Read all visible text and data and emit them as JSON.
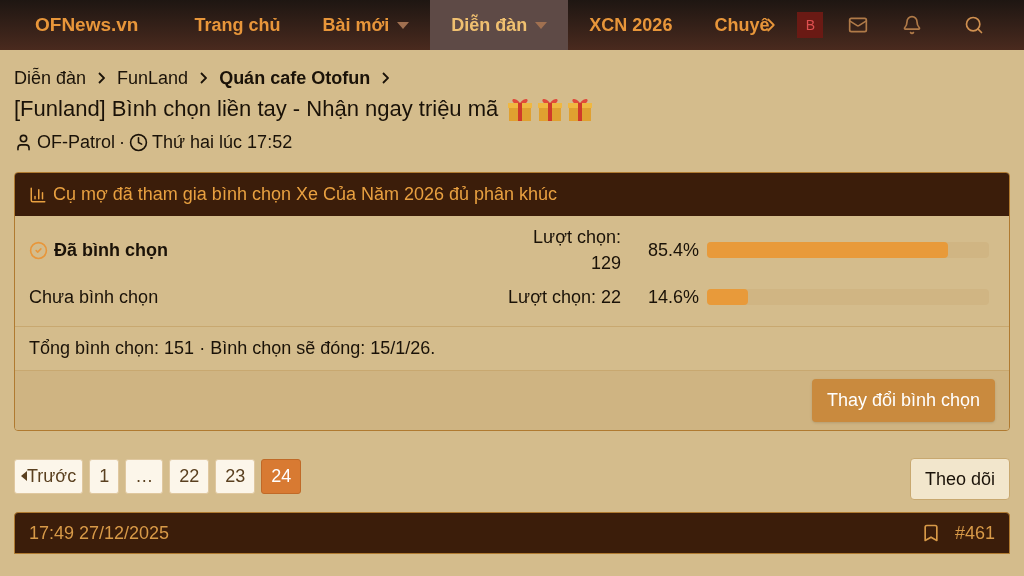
{
  "nav": {
    "logo": "OFNews.vn",
    "items": [
      {
        "label": "Trang chủ",
        "dropdown": false,
        "selected": false
      },
      {
        "label": "Bài mới",
        "dropdown": true,
        "selected": false
      },
      {
        "label": "Diễn đàn",
        "dropdown": true,
        "selected": true
      },
      {
        "label": "XCN 2026",
        "dropdown": false,
        "selected": false
      },
      {
        "label": "Chuyê",
        "dropdown": false,
        "selected": false
      }
    ],
    "avatar": "B"
  },
  "breadcrumb": [
    {
      "label": "Diễn đàn",
      "current": false
    },
    {
      "label": "FunLand",
      "current": false
    },
    {
      "label": "Quán cafe Otofun",
      "current": true
    }
  ],
  "thread": {
    "title": "[Funland] Bình chọn liền tay - Nhận ngay triệu mã",
    "author": "OF-Patrol",
    "separator": "·",
    "time": "Thứ hai lúc 17:52"
  },
  "poll": {
    "title": "Cụ mợ đã tham gia bình chọn Xe Của Năm 2026 đủ phân khúc",
    "options": [
      {
        "label": "Đã bình chọn",
        "selected": true,
        "votes": "Lượt chọn: 129",
        "percent": "85.4%",
        "level": 0.854
      },
      {
        "label": "Chưa bình chọn",
        "selected": false,
        "votes": "Lượt chọn: 22",
        "percent": "14.6%",
        "level": 0.146
      }
    ],
    "summary": "Tổng bình chọn: 151 · Bình chọn sẽ đóng: 15/1/26.",
    "button": "Thay đổi bình chọn"
  },
  "pagination": {
    "prev": "Trước",
    "pages": [
      {
        "label": "1",
        "selected": false
      },
      {
        "label": "…",
        "selected": false
      },
      {
        "label": "22",
        "selected": false
      },
      {
        "label": "23",
        "selected": false
      },
      {
        "label": "24",
        "selected": true
      }
    ]
  },
  "watch_button": "Theo dõi",
  "post": {
    "time": "17:49 27/12/2025",
    "number": "#461"
  }
}
